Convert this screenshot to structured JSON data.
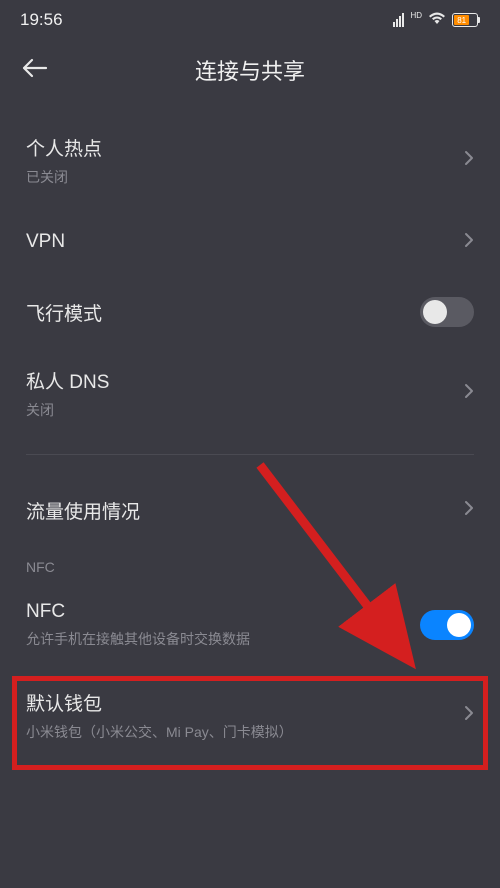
{
  "statusBar": {
    "time": "19:56",
    "batteryPercent": "81"
  },
  "header": {
    "title": "连接与共享"
  },
  "items": {
    "hotspot": {
      "title": "个人热点",
      "sub": "已关闭"
    },
    "vpn": {
      "title": "VPN"
    },
    "airplane": {
      "title": "飞行模式"
    },
    "privateDns": {
      "title": "私人 DNS",
      "sub": "关闭"
    },
    "dataUsage": {
      "title": "流量使用情况"
    },
    "nfcHeader": "NFC",
    "nfc": {
      "title": "NFC",
      "sub": "允许手机在接触其他设备时交换数据"
    },
    "defaultWallet": {
      "title": "默认钱包",
      "sub": "小米钱包（小米公交、Mi Pay、门卡模拟）"
    }
  }
}
